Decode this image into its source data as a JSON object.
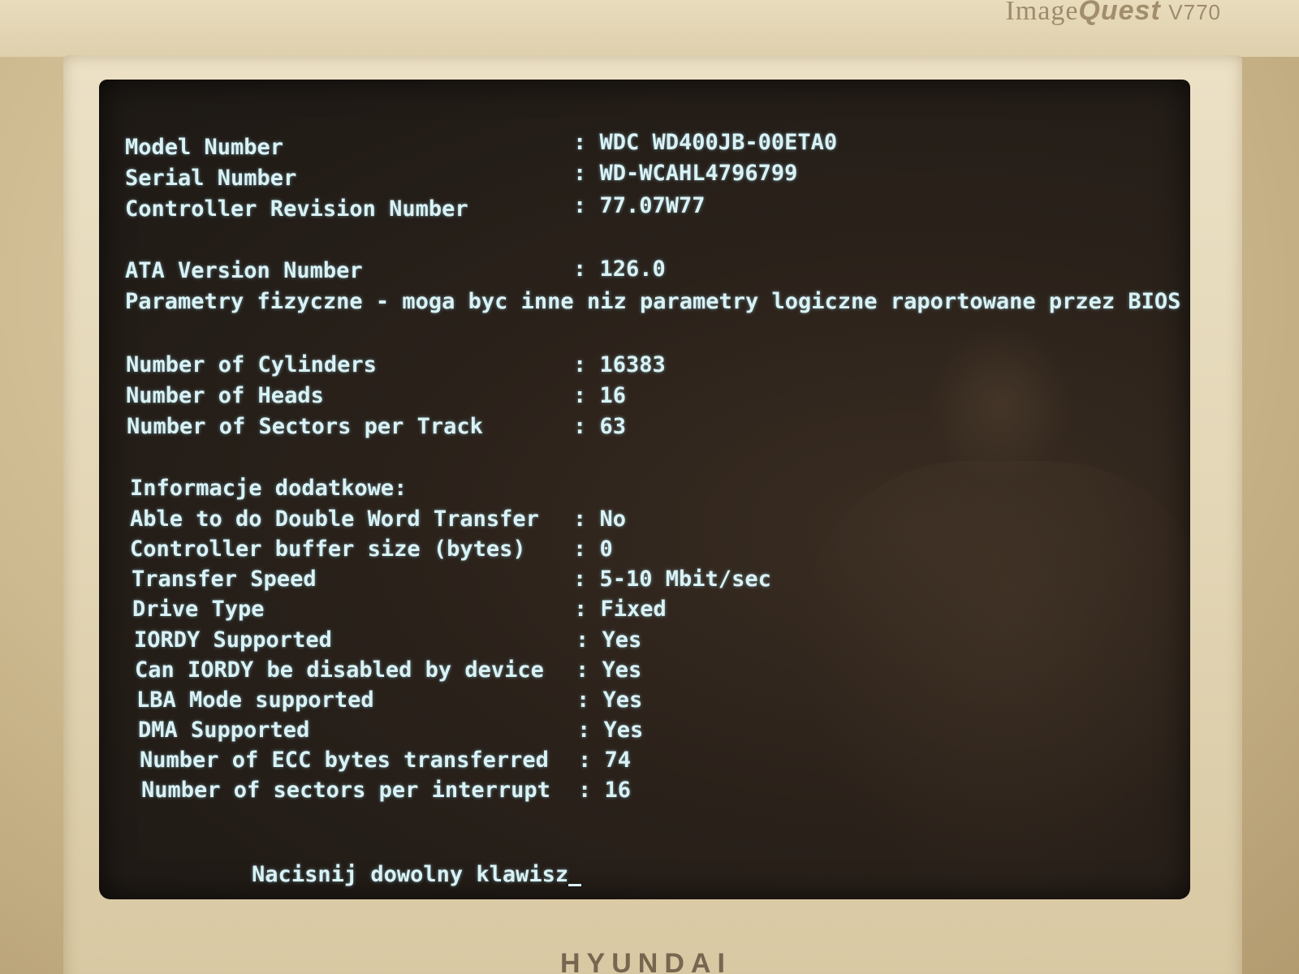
{
  "bezel": {
    "brand_top": "ImageQuest",
    "brand_top_prefix": "Image",
    "brand_top_suffix": "Quest",
    "model": "V770",
    "brand_bottom": "HYUNDAI"
  },
  "disk_info": {
    "identity": [
      {
        "label": "Model Number",
        "value": ": WDC WD400JB-00ETA0"
      },
      {
        "label": "Serial Number",
        "value": ": WD-WCAHL4796799"
      },
      {
        "label": "Controller Revision Number",
        "value": ": 77.07W77"
      }
    ],
    "ata_version": {
      "label": "ATA Version Number",
      "value": ": 126.0"
    },
    "physical_note": "Parametry fizyczne - moga byc inne niz parametry logiczne raportowane przez BIOS",
    "geometry": [
      {
        "label": "Number of Cylinders",
        "value": ": 16383"
      },
      {
        "label": "Number of Heads",
        "value": ": 16"
      },
      {
        "label": "Number of Sectors per Track",
        "value": ": 63"
      }
    ],
    "extra_header": "Informacje dodatkowe:",
    "extra": [
      {
        "label": "Able to do Double Word Transfer",
        "value": ": No"
      },
      {
        "label": "Controller buffer size (bytes)",
        "value": ": 0"
      },
      {
        "label": "Transfer Speed",
        "value": ": 5-10 Mbit/sec"
      },
      {
        "label": "Drive Type",
        "value": ": Fixed"
      },
      {
        "label": "IORDY Supported",
        "value": ": Yes"
      },
      {
        "label": "Can IORDY be disabled by device",
        "value": ": Yes"
      },
      {
        "label": "LBA Mode supported",
        "value": ": Yes"
      },
      {
        "label": "DMA Supported",
        "value": ": Yes"
      },
      {
        "label": "Number of ECC bytes transferred",
        "value": ": 74"
      },
      {
        "label": "Number of sectors per interrupt",
        "value": ": 16"
      }
    ],
    "prompt": "Nacisnij dowolny klawisz"
  },
  "colors": {
    "terminal_text": "#d9f2f6",
    "screen_background": "#2a211a",
    "bezel": "#e3d6b6"
  }
}
